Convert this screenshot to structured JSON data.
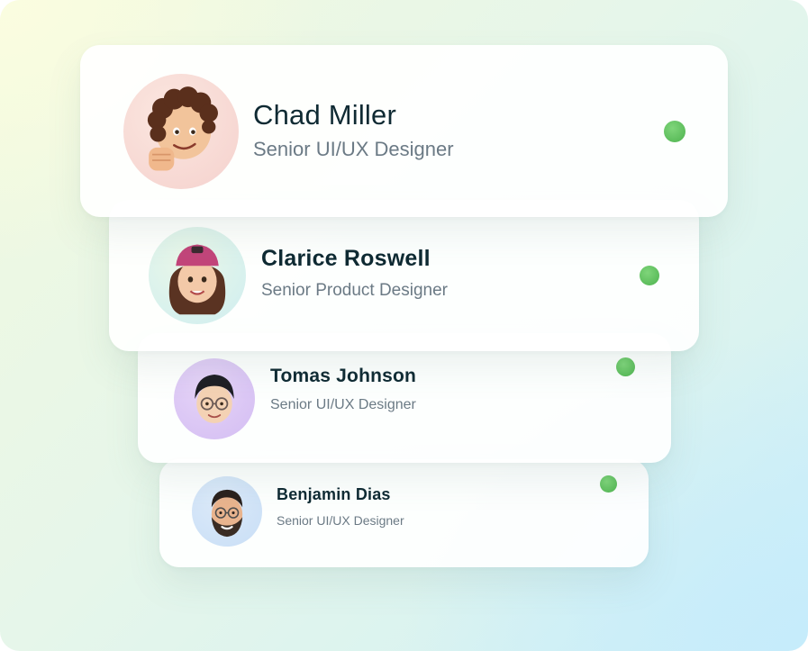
{
  "colors": {
    "status_online": "#5cbf5b",
    "name_text": "#0f2a33",
    "role_text": "#6b7a85"
  },
  "members": [
    {
      "name": "Chad Miller",
      "role": "Senior UI/UX Designer",
      "avatar_icon": "memoji-curly-hair-fist-avatar",
      "status": "online-dot-icon"
    },
    {
      "name": "Clarice Roswell",
      "role": "Senior Product Designer",
      "avatar_icon": "memoji-pink-cap-avatar",
      "status": "online-dot-icon"
    },
    {
      "name": "Tomas Johnson",
      "role": "Senior UI/UX Designer",
      "avatar_icon": "memoji-glasses-avatar",
      "status": "online-dot-icon"
    },
    {
      "name": "Benjamin Dias",
      "role": "Senior UI/UX Designer",
      "avatar_icon": "memoji-beard-glasses-avatar",
      "status": "online-dot-icon"
    }
  ]
}
